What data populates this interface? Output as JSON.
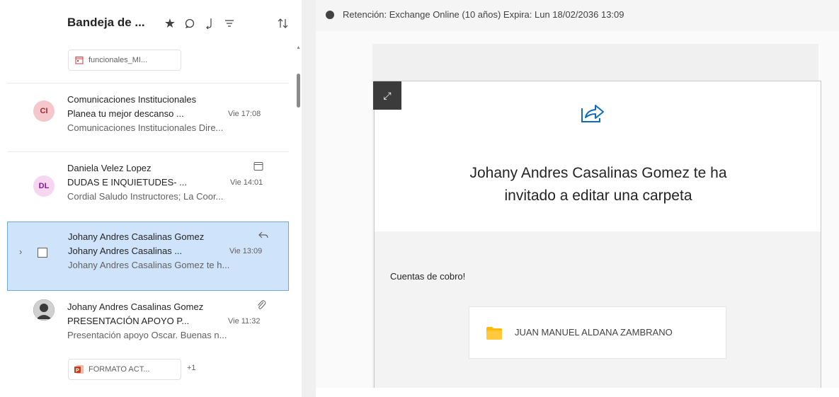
{
  "list": {
    "folder_title": "Bandeja de ...",
    "header_icons": [
      "star-icon",
      "chat-bubble-icon",
      "reply-down-icon",
      "filter-icon",
      "sort-icon"
    ],
    "top_attachment": "funcionales_MI...",
    "messages": [
      {
        "initials": "CI",
        "avatar_color": "#f4c7cc",
        "avatar_text_color": "#a4262c",
        "sender": "Comunicaciones Institucionales",
        "subject": "Planea tu mejor descanso ...",
        "time": "Vie 17:08",
        "preview": "Comunicaciones Institucionales Dire..."
      },
      {
        "initials": "DL",
        "avatar_color": "#f6d6f0",
        "avatar_text_color": "#881798",
        "sender": "Daniela Velez Lopez",
        "subject": "DUDAS E INQUIETUDES- ...",
        "time": "Vie 14:01",
        "preview": "Cordial Saludo Instructores; La Coor..."
      },
      {
        "sender": "Johany Andres Casalinas Gomez",
        "subject": "Johany Andres Casalinas ...",
        "time": "Vie 13:09",
        "preview": "Johany Andres Casalinas Gomez te h..."
      },
      {
        "sender": "Johany Andres Casalinas Gomez",
        "subject": "PRESENTACIÓN APOYO P...",
        "time": "Vie 11:32",
        "preview": "Presentación apoyo Oscar. Buenas n...",
        "attachment": "FORMATO ACT...",
        "attachment_more": "+1"
      }
    ]
  },
  "reading": {
    "retention": "Retención: Exchange Online (10 años) Expira: Lun 18/02/2036 13:09",
    "invite_title": "Johany Andres Casalinas Gomez te ha invitado a editar una carpeta",
    "note": "Cuentas de cobro!",
    "folder_name": "JUAN MANUEL ALDANA ZAMBRANO"
  },
  "colors": {
    "selected_bg": "#cfe4fa",
    "selected_border": "#6fa8dc",
    "share_icon": "#0f6cbd",
    "folder_icon": "#ffb900"
  }
}
